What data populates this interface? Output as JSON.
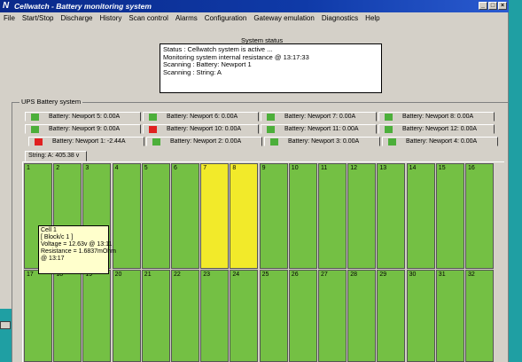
{
  "window": {
    "title": "Cellwatch  -  Battery monitoring system",
    "app_icon": "N"
  },
  "menu": [
    "File",
    "Start/Stop",
    "Discharge",
    "History",
    "Scan control",
    "Alarms",
    "Configuration",
    "Gateway emulation",
    "Diagnostics",
    "Help"
  ],
  "status": {
    "label": "System status",
    "lines": [
      "Status : Cellwatch system is active ...",
      "Monitoring system internal resistance  @ 13:17:33",
      "Scanning : Battery: Newport 1",
      "Scanning : String: A"
    ]
  },
  "ups": {
    "label": "UPS Battery system",
    "rows": [
      [
        {
          "label": "Battery: Newport 5: 0.00A",
          "color": "#4caf3a"
        },
        {
          "label": "Battery: Newport 6: 0.00A",
          "color": "#4caf3a"
        },
        {
          "label": "Battery: Newport 7: 0.00A",
          "color": "#4caf3a"
        },
        {
          "label": "Battery: Newport 8: 0.00A",
          "color": "#4caf3a"
        }
      ],
      [
        {
          "label": "Battery: Newport 9: 0.00A",
          "color": "#4caf3a"
        },
        {
          "label": "Battery: Newport 10: 0.00A",
          "color": "#e02020"
        },
        {
          "label": "Battery: Newport 11: 0.00A",
          "color": "#4caf3a"
        },
        {
          "label": "Battery: Newport 12: 0.00A",
          "color": "#4caf3a"
        }
      ],
      [
        {
          "label": "Battery: Newport 1: -2.44A",
          "color": "#e02020"
        },
        {
          "label": "Battery: Newport 2: 0.00A",
          "color": "#4caf3a"
        },
        {
          "label": "Battery: Newport 3: 0.00A",
          "color": "#4caf3a"
        },
        {
          "label": "Battery: Newport 4: 0.00A",
          "color": "#4caf3a"
        }
      ]
    ]
  },
  "string_tab": "String: A: 405.38 v",
  "cells": {
    "numbers": [
      "1",
      "2",
      "3",
      "4",
      "5",
      "6",
      "7",
      "8",
      "9",
      "10",
      "11",
      "12",
      "13",
      "14",
      "15",
      "16",
      "17",
      "18",
      "19",
      "20",
      "21",
      "22",
      "23",
      "24",
      "25",
      "26",
      "27",
      "28",
      "29",
      "30",
      "31",
      "32"
    ],
    "highlighted": [
      "7",
      "8"
    ],
    "normal_color": "#74c044",
    "highlight_color": "#f2ea2a"
  },
  "tooltip": {
    "lines": [
      "Cell 1",
      "[ Block/c 1 ]",
      "Voltage = 12.63v @ 13:11",
      "Resistance = 1.6837mOhm",
      "@ 13:17"
    ]
  }
}
